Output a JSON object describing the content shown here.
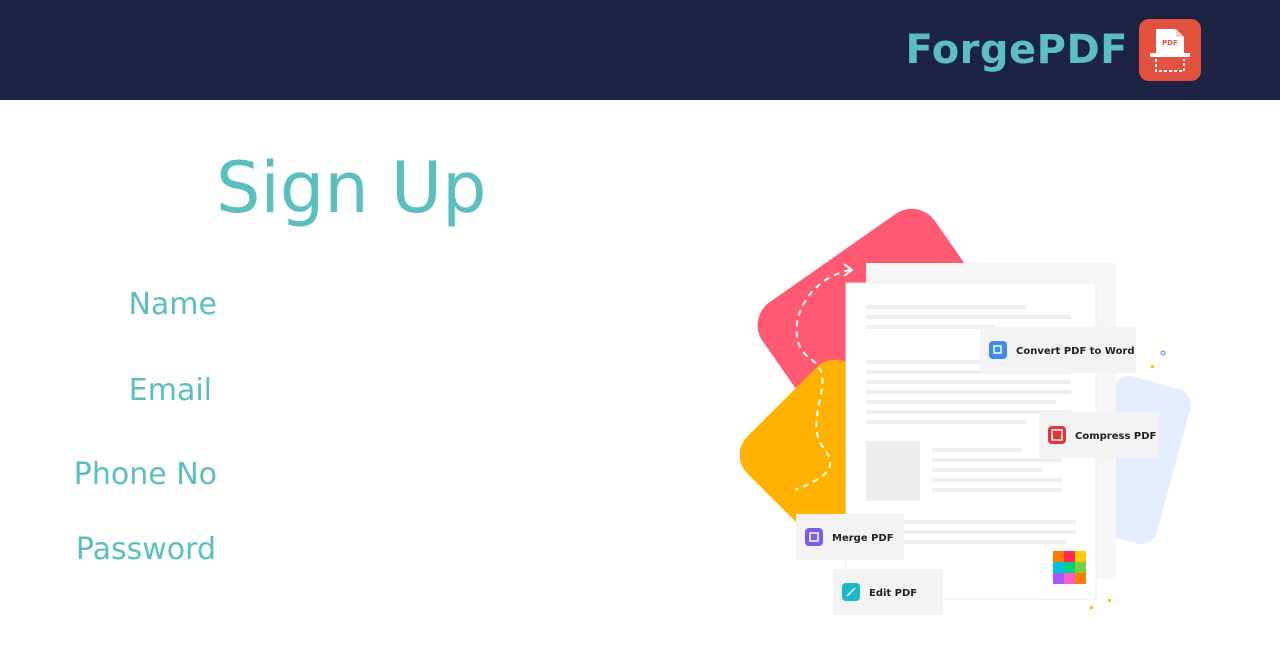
{
  "header": {
    "brand": "ForgePDF",
    "logo_icon": "pdf-scan-icon",
    "logo_badge": "PDF"
  },
  "form": {
    "title": "Sign Up",
    "fields": [
      {
        "label": "Name",
        "value": ""
      },
      {
        "label": "Email",
        "value": ""
      },
      {
        "label": "Phone No",
        "value": ""
      },
      {
        "label": "Password",
        "value": ""
      }
    ]
  },
  "illustration": {
    "features": [
      {
        "label": "Convert PDF to Word",
        "icon": "convert-word-icon",
        "color": "#3b8cf0"
      },
      {
        "label": "Compress PDF",
        "icon": "compress-icon",
        "color": "#e8333a"
      },
      {
        "label": "Merge PDF",
        "icon": "merge-icon",
        "color": "#7b5cf0"
      },
      {
        "label": "Edit PDF",
        "icon": "edit-icon",
        "color": "#1ab8c8"
      }
    ]
  },
  "colors": {
    "header_bg": "#1d2443",
    "accent": "#5bbfbf",
    "logo_bg": "#e2523f",
    "card_pink": "#ff5a72",
    "card_yellow": "#ffb300",
    "card_blue": "#e4edff"
  }
}
